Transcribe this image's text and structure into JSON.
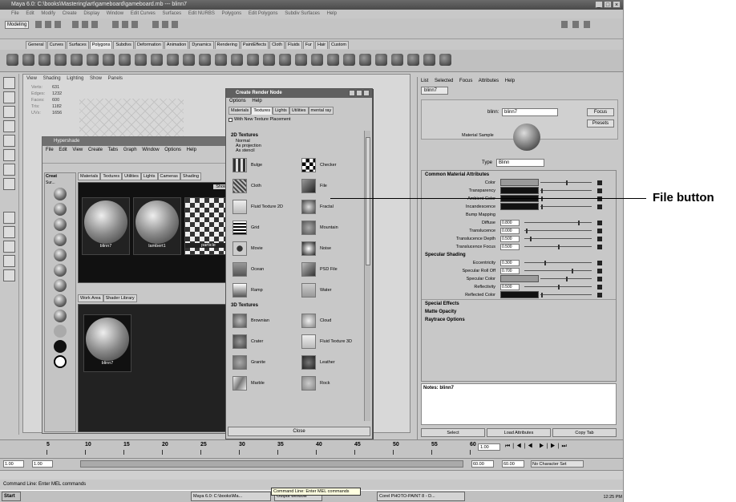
{
  "app": {
    "title": "Maya 6.0: C:\\books\\Mastering\\art\\gameboard\\gameboard.mb --- blinn7",
    "window_controls": [
      "_",
      "□",
      "×"
    ],
    "menus": [
      "File",
      "Edit",
      "Modify",
      "Create",
      "Display",
      "Window",
      "Edit Curves",
      "Surfaces",
      "Edit NURBS",
      "Polygons",
      "Edit Polygons",
      "Subdiv Surfaces",
      "Help"
    ],
    "mode": "Modeling"
  },
  "shelf_tabs": [
    "General",
    "Curves",
    "Surfaces",
    "Polygons",
    "Subdivs",
    "Deformation",
    "Animation",
    "Dynamics",
    "Rendering",
    "PaintEffects",
    "Cloth",
    "Fluids",
    "Fur",
    "Hair",
    "Custom"
  ],
  "viewport": {
    "menus": [
      "View",
      "Shading",
      "Lighting",
      "Show",
      "Panels"
    ],
    "hud": [
      {
        "label": "Verts:",
        "value": "631"
      },
      {
        "label": "Edges:",
        "value": "1232"
      },
      {
        "label": "Faces:",
        "value": "600"
      },
      {
        "label": "Tris:",
        "value": "1182"
      },
      {
        "label": "UVs:",
        "value": "1656"
      }
    ]
  },
  "hypershade": {
    "title": "Hypershade",
    "menus": [
      "File",
      "Edit",
      "View",
      "Create",
      "Tabs",
      "Graph",
      "Window",
      "Options",
      "Help"
    ],
    "tabs": [
      "Materials",
      "Textures",
      "Utilities",
      "Lights",
      "Cameras",
      "Shading"
    ],
    "show_button": "Show",
    "left_tabs": [
      "Creat",
      "Sur..."
    ],
    "materials": [
      "blinn7",
      "lambert1",
      "particle"
    ],
    "bottom_tabs": [
      "Work Area",
      "Shader Library"
    ],
    "work_node": "blinn7"
  },
  "create_render_node": {
    "title": "Create Render Node",
    "menus": [
      "Options",
      "Help"
    ],
    "tabs": [
      "Materials",
      "Textures",
      "Lights",
      "Utilities",
      "mental ray"
    ],
    "active_tab": "Textures",
    "checkbox": "With New Texture Placement",
    "section_2d": "2D Textures",
    "radios": [
      "Normal",
      "As projection",
      "As stencil"
    ],
    "textures_2d": [
      "Bulge",
      "Checker",
      "Cloth",
      "File",
      "Fluid Texture 2D",
      "Fractal",
      "Grid",
      "Mountain",
      "Movie",
      "Noise",
      "Ocean",
      "PSD File",
      "Ramp",
      "Water"
    ],
    "section_3d": "3D Textures",
    "textures_3d": [
      "Brownian",
      "Cloud",
      "Crater",
      "Fluid Texture 3D",
      "Granite",
      "Leather",
      "Marble",
      "Rock"
    ],
    "close_button": "Close"
  },
  "attribute_editor": {
    "menus": [
      "List",
      "Selected",
      "Focus",
      "Attributes",
      "Help"
    ],
    "tab": "blinn7",
    "name_label": "blinn:",
    "name_value": "blinn7",
    "focus_button": "Focus",
    "presets_button": "Presets",
    "sample_label": "Material Sample",
    "type_label": "Type",
    "type_value": "Blinn",
    "section_common": "Common Material Attributes",
    "common_attrs": [
      {
        "label": "Color",
        "kind": "swatch",
        "color": "#9a9a9a",
        "knob": 0.5
      },
      {
        "label": "Transparency",
        "kind": "swatch",
        "color": "#111111",
        "knob": 0.02
      },
      {
        "label": "Ambient Color",
        "kind": "swatch",
        "color": "#111111",
        "knob": 0.02
      },
      {
        "label": "Incandescence",
        "kind": "swatch",
        "color": "#111111",
        "knob": 0.02
      },
      {
        "label": "Bump Mapping",
        "kind": "empty"
      },
      {
        "label": "Diffuse",
        "kind": "field",
        "value": "0.800",
        "knob": 0.8
      },
      {
        "label": "Translucence",
        "kind": "field",
        "value": "0.000",
        "knob": 0.02
      },
      {
        "label": "Translucence Depth",
        "kind": "field",
        "value": "0.500",
        "knob": 0.08
      },
      {
        "label": "Translucence Focus",
        "kind": "field",
        "value": "0.500",
        "knob": 0.5
      }
    ],
    "section_specular": "Specular Shading",
    "specular_attrs": [
      {
        "label": "Eccentricity",
        "kind": "field",
        "value": "0.300",
        "knob": 0.3
      },
      {
        "label": "Specular Roll Off",
        "kind": "field",
        "value": "0.700",
        "knob": 0.7
      },
      {
        "label": "Specular Color",
        "kind": "swatch",
        "color": "#9a9a9a",
        "knob": 0.5
      },
      {
        "label": "Reflectivity",
        "kind": "field",
        "value": "0.500",
        "knob": 0.5
      },
      {
        "label": "Reflected Color",
        "kind": "swatch",
        "color": "#111111",
        "knob": 0.02
      }
    ],
    "collapsed_sections": [
      "Special Effects",
      "Matte Opacity",
      "Raytrace Options"
    ],
    "notes_label": "Notes: blinn7",
    "buttons": [
      "Select",
      "Load Attributes",
      "Copy Tab"
    ]
  },
  "timeline": {
    "ticks": [
      "5",
      "10",
      "15",
      "20",
      "25",
      "30",
      "35",
      "40",
      "45",
      "50",
      "55",
      "60"
    ],
    "current_frame": "1.00",
    "start": "1.00",
    "end_a": "60.00",
    "end_b": "60.00",
    "character_set": "No Character Set"
  },
  "command_line": "Command Line: Enter MEL commands",
  "tooltip": "Command Line: Enter MEL commands",
  "taskbar": {
    "start": "Start",
    "tasks": [
      "Maya 6.0: C:\\books\\Ma...",
      "Output Window",
      "Corel PHOTO-PAINT 8 - D..."
    ],
    "clock": "12:25 PM"
  },
  "callout": {
    "label": "File button"
  }
}
